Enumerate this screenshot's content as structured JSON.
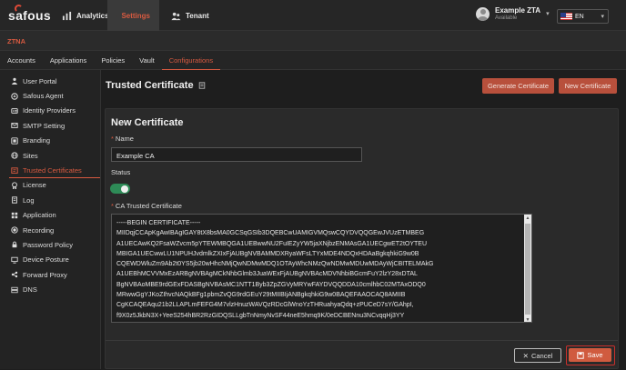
{
  "brand": {
    "logo_text": "safous"
  },
  "topnav": {
    "items": [
      {
        "label": "Analytics",
        "icon": "analytics-icon"
      },
      {
        "label": "Settings",
        "icon": "gear-icon",
        "active": true
      },
      {
        "label": "Tenant",
        "icon": "tenant-icon"
      }
    ]
  },
  "user": {
    "name": "Example ZTA",
    "status": "Available"
  },
  "language": {
    "code": "EN",
    "flag": "us-flag-icon"
  },
  "section": {
    "title": "ZTNA"
  },
  "subnav": {
    "items": [
      {
        "label": "Accounts"
      },
      {
        "label": "Applications"
      },
      {
        "label": "Policies"
      },
      {
        "label": "Vault"
      },
      {
        "label": "Configurations",
        "active": true
      }
    ]
  },
  "sidebar": {
    "items": [
      {
        "label": "User Portal",
        "icon": "user-icon"
      },
      {
        "label": "Safous Agent",
        "icon": "agent-icon"
      },
      {
        "label": "Identity Providers",
        "icon": "identity-icon"
      },
      {
        "label": "SMTP Setting",
        "icon": "mail-icon"
      },
      {
        "label": "Branding",
        "icon": "branding-icon"
      },
      {
        "label": "Sites",
        "icon": "globe-icon"
      },
      {
        "label": "Trusted Certificates",
        "icon": "certificate-icon",
        "active": true
      },
      {
        "label": "License",
        "icon": "license-icon"
      },
      {
        "label": "Log",
        "icon": "log-icon"
      },
      {
        "label": "Application",
        "icon": "application-icon"
      },
      {
        "label": "Recording",
        "icon": "recording-icon"
      },
      {
        "label": "Password Policy",
        "icon": "password-icon"
      },
      {
        "label": "Device Posture",
        "icon": "device-icon"
      },
      {
        "label": "Forward Proxy",
        "icon": "proxy-icon"
      },
      {
        "label": "DNS",
        "icon": "dns-icon"
      }
    ]
  },
  "page": {
    "title": "Trusted Certificate",
    "generate_label": "Generate Certificate",
    "new_label": "New Certificate"
  },
  "form": {
    "title": "New Certificate",
    "name_label": "Name",
    "name_value": "Example CA",
    "status_label": "Status",
    "status_on": true,
    "ca_label": "CA Trusted Certificate",
    "ca_lines": [
      "-----BEGIN CERTIFICATE-----",
      "MIIDqjCCApKgAwIBAgIGAY8tX8bsMA0GCSqGSIb3DQEBCwUAMIGVMQswCQYDVQQGEwJVUzETMBEG",
      "A1UECAwKQ2FsaWZvcm5pYTEWMBQGA1UEBwwNU2FuIEZyYW5jaXNjbzENMAsGA1UECgwET2tOYTEU",
      "MBIGA1UECwwLU1NPUHJvdmlkZXIxFjAUBgNVBAMMDXRyaWFsLTYxMDE4NDQxHDAaBgkqhkiG9w0B",
      "CQEWDWluZm9Ab2t0YS5jb20wHhcNMjQwNDMwMDQ1OTAyWhcNMzQwNDMwMDUwMDAyWjCBITELMAkG",
      "A1UEBhMCVVMxEzARBgNVBAgMCkNhbGlmb3JuaWExFjAUBgNVBAcMDVNhbiBGcmFuY2lzY28xDTAL",
      "BgNVBAoMBE9rdGExFDASBgNVBAsMC1NTT1Byb3ZpZGVyMRYwFAYDVQQDDA10cmlhbC02MTAxODQ0",
      "MRwwGgYJKoZIhvcNAQkBFg1pbmZvQG9rdGEuY29tMIIBIjANBgkqhkiG9w0BAQEFAAOCAQ8AMIIB",
      "CgKCAQEAqu21b2LLAPLmFEFG4M7vlzHnuzWAVQzRDcGlWnoYzTHRuahyaQdq+zPUCeD7sY/GAhpI,",
      "f9X0z5JkbN3X+YeeS254hBR2RzGIDQSLLgbTnNmyNvSF44neE5hmq9K/0eDCBENnu3NCvqqHj3YY"
    ]
  },
  "actions": {
    "cancel_label": "Cancel",
    "save_label": "Save"
  },
  "colors": {
    "accent": "#d85a40",
    "toggle_on": "#2e8b57",
    "background": "#1e1e1e"
  }
}
